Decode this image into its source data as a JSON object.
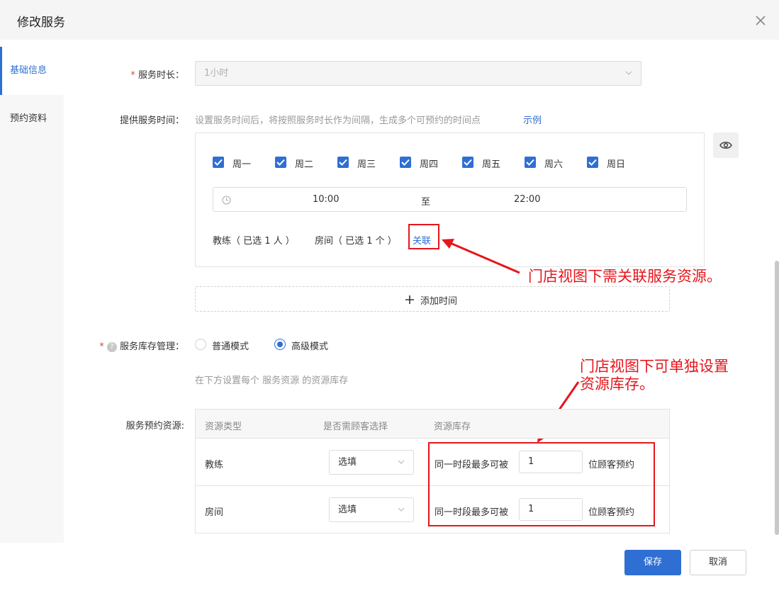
{
  "dialog": {
    "title": "修改服务"
  },
  "sidebar": {
    "items": [
      {
        "label": "基础信息"
      },
      {
        "label": "预约资料"
      }
    ]
  },
  "duration": {
    "required_mark": "*",
    "label": "服务时长：",
    "value": "1小时"
  },
  "service_time": {
    "label": "提供服务时间：",
    "hint": "设置服务时间后，将按照服务时长作为间隔，生成多个可预约的时间点",
    "example_link": "示例",
    "days": [
      {
        "label": "周一",
        "checked": true
      },
      {
        "label": "周二",
        "checked": true
      },
      {
        "label": "周三",
        "checked": true
      },
      {
        "label": "周四",
        "checked": true
      },
      {
        "label": "周五",
        "checked": true
      },
      {
        "label": "周六",
        "checked": true
      },
      {
        "label": "周日",
        "checked": true
      }
    ],
    "range": {
      "start": "10:00",
      "separator": "至",
      "end": "22:00"
    },
    "coach": "教练（ 已选 1 人 ）",
    "room": "房间（ 已选 1 个 ）",
    "link_label": "关联",
    "add_time": "添加时间"
  },
  "inventory": {
    "required_mark": "*",
    "help_icon": "?",
    "label": "服务库存管理：",
    "options": [
      {
        "label": "普通模式",
        "selected": false
      },
      {
        "label": "高级模式",
        "selected": true
      }
    ],
    "hint": "在下方设置每个 服务资源 的资源库存"
  },
  "resources": {
    "label": "服务预约资源:",
    "headers": [
      "资源类型",
      "是否需顾客选择",
      "资源库存"
    ],
    "rows": [
      {
        "type": "教练",
        "select": "选填",
        "prefix": "同一时段最多可被",
        "value": "1",
        "suffix": "位顾客预约"
      },
      {
        "type": "房间",
        "select": "选填",
        "prefix": "同一时段最多可被",
        "value": "1",
        "suffix": "位顾客预约"
      }
    ]
  },
  "annotations": {
    "note1": "门店视图下需关联服务资源。",
    "note2_line1": "门店视图下可单独设置",
    "note2_line2": "资源库存。",
    "color": "#e5161c"
  },
  "footer": {
    "save": "保存",
    "cancel": "取消"
  },
  "colors": {
    "primary": "#2f6fd3",
    "required": "#e0443a"
  },
  "icons": {
    "close": "close-icon",
    "clock": "clock-icon",
    "eye": "eye-icon",
    "plus": "plus-icon",
    "chevron": "chevron-down-icon",
    "help": "help-icon"
  }
}
